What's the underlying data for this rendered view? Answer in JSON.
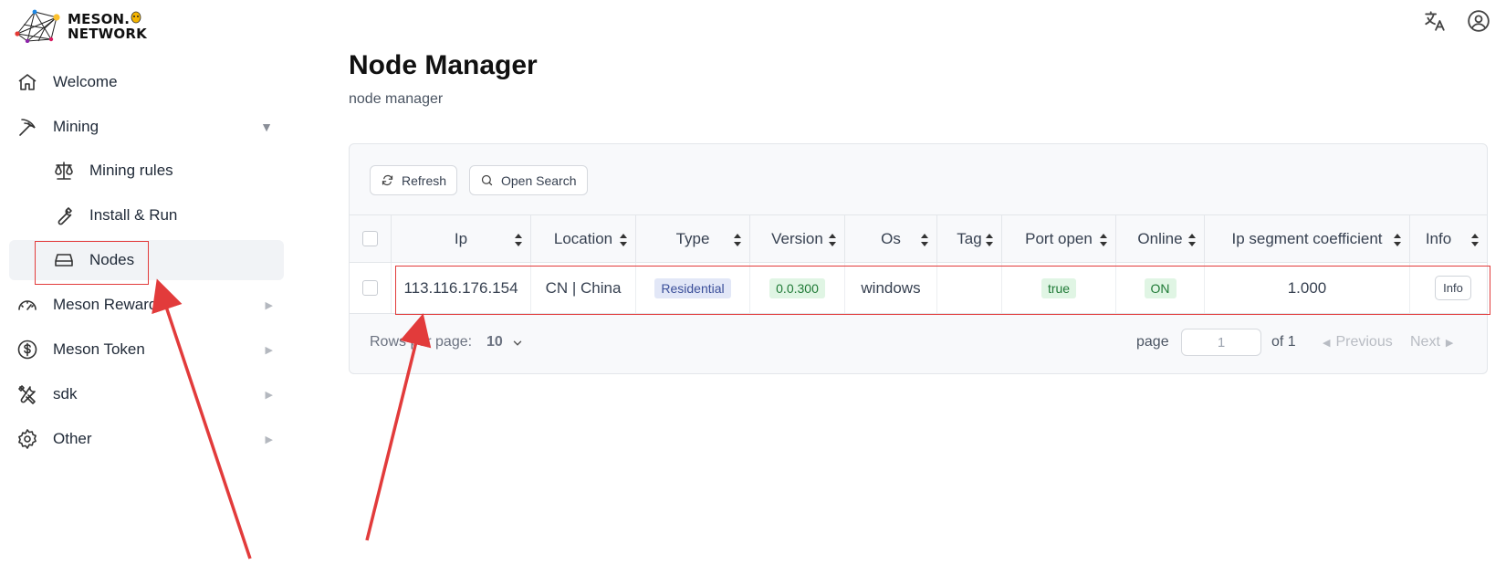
{
  "brand": {
    "line1": "MESON.",
    "line2": "NETWORK",
    "colors": {
      "node_red": "#e53935",
      "node_blue": "#1e88e5",
      "node_yellow": "#fbc02d",
      "node_magenta": "#d81b60"
    }
  },
  "header": {
    "icons": [
      "translate-icon",
      "user-account-icon"
    ]
  },
  "sidebar": {
    "items": [
      {
        "label": "Welcome",
        "icon": "home-icon"
      },
      {
        "label": "Mining",
        "icon": "pickaxe-icon",
        "arrow": "▼"
      },
      {
        "label": "Mining rules",
        "icon": "scale-icon"
      },
      {
        "label": "Install & Run",
        "icon": "wrench-icon"
      },
      {
        "label": "Nodes",
        "icon": "drive-icon"
      },
      {
        "label": "Meson Reward",
        "icon": "gauge-icon",
        "arrow": "▶"
      },
      {
        "label": "Meson Token",
        "icon": "dollar-icon",
        "arrow": "▶"
      },
      {
        "label": "sdk",
        "icon": "tools-icon",
        "arrow": "▶"
      },
      {
        "label": "Other",
        "icon": "gear-icon",
        "arrow": "▶"
      }
    ]
  },
  "main": {
    "title": "Node Manager",
    "subtitle": "node manager",
    "toolbar": {
      "refresh_label": "Refresh",
      "search_label": "Open Search"
    },
    "table": {
      "columns": [
        "Ip",
        "Location",
        "Type",
        "Version",
        "Os",
        "Tag",
        "Port open",
        "Online",
        "Ip segment coefficient",
        "Info"
      ],
      "rows": [
        {
          "ip": "113.116.176.154",
          "location": "CN | China",
          "type": "Residential",
          "version": "0.0.300",
          "os": "windows",
          "tag": "",
          "port_open": "true",
          "online": "ON",
          "coefficient": "1.000",
          "info": "Info"
        }
      ]
    },
    "pagination": {
      "rows_per_page_label": "Rows per page:",
      "rows_per_page_value": "10",
      "page_label": "page",
      "page_value": "1",
      "of_label": "of 1",
      "previous_label": "Previous",
      "next_label": "Next"
    }
  },
  "annotations": {
    "highlight_color": "#e23b3b"
  }
}
